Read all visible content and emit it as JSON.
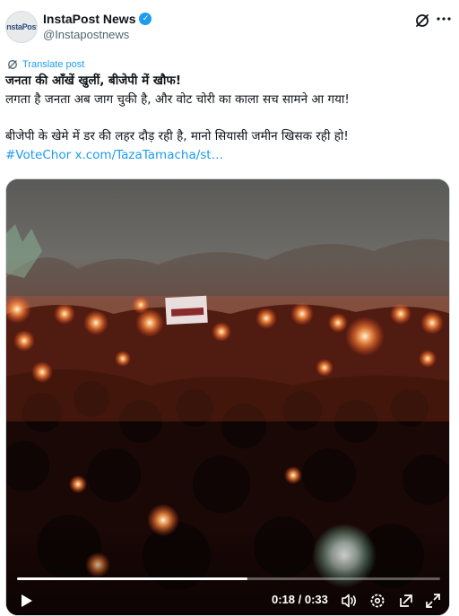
{
  "account": {
    "display_name": "InstaPost News",
    "handle": "@Instapostnews",
    "avatar_text": "InstaPost",
    "verified": true
  },
  "translate": {
    "label": "Translate post"
  },
  "tweet": {
    "title": "जनता की आँखें खुलीं, बीजेपी में खौफ!",
    "line1": "लगता है जनता अब जाग चुकी है, और वोट चोरी का काला सच सामने आ गया!",
    "line2": "बीजेपी के खेमे में डर की लहर दौड़ रही है, मानो सियासी जमीन खिसक रही हो!",
    "hashtag": "#VoteChor",
    "link": "x.com/TazaTamacha/st…"
  },
  "video": {
    "time_display": "0:18 / 0:33",
    "progress": 0.545
  },
  "colors": {
    "accent": "#1d9bf0",
    "text": "#0f1419",
    "secondary": "#536471"
  },
  "icons": {
    "grok": "grok-icon",
    "more": "more-icon",
    "translate": "translate-icon",
    "play": "play-icon",
    "volume": "volume-icon",
    "settings": "settings-icon",
    "popout": "popout-icon",
    "fullscreen": "fullscreen-icon"
  }
}
